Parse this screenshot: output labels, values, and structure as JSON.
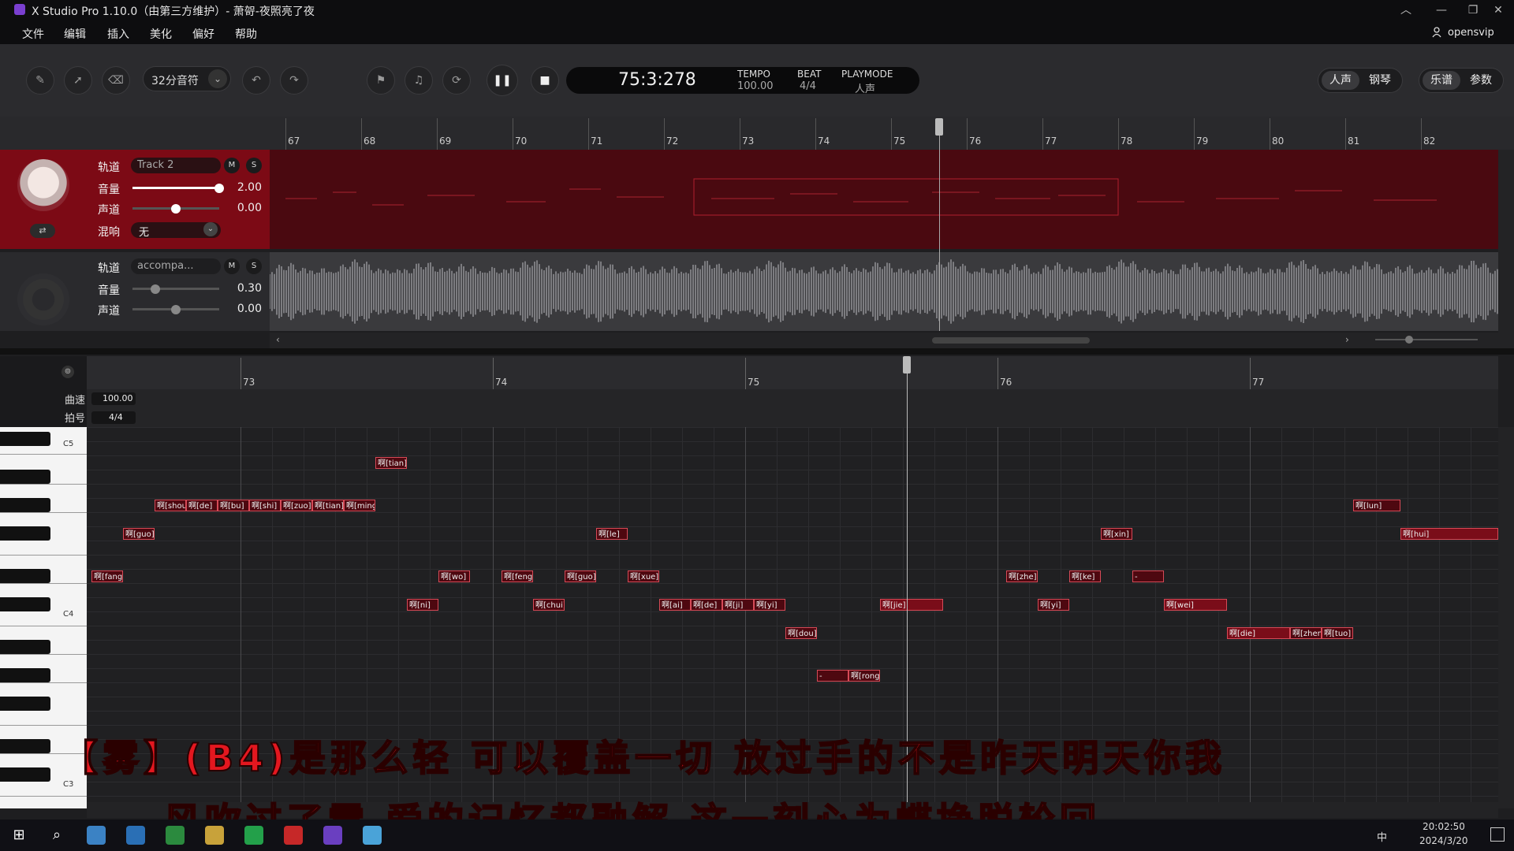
{
  "window": {
    "title": "X Studio Pro 1.10.0（由第三方维护）- 萧哿-夜照亮了夜",
    "controls": {
      "minimize": "—",
      "maximize": "❐",
      "close": "✕",
      "restore": "︿"
    }
  },
  "menu": {
    "items": [
      "文件",
      "编辑",
      "插入",
      "美化",
      "偏好",
      "帮助"
    ],
    "user": "opensvip"
  },
  "toolbar": {
    "note_value": "32分音符",
    "time": "75:3:278",
    "tempo_label": "TEMPO",
    "tempo_value": "100.00",
    "beat_label": "BEAT",
    "beat_value": "4/4",
    "playmode_label": "PLAYMODE",
    "playmode_value": "人声",
    "voice_tabs": [
      "人声",
      "钢琴"
    ],
    "view_tabs": [
      "乐谱",
      "参数"
    ]
  },
  "arrangement": {
    "measures": [
      "67",
      "68",
      "69",
      "70",
      "71",
      "72",
      "73",
      "74",
      "75",
      "76",
      "77",
      "78",
      "79",
      "80",
      "81",
      "82"
    ],
    "track1": {
      "track_label": "轨道",
      "name": "Track 2",
      "mute": "M",
      "solo": "S",
      "volume_label": "音量",
      "volume": "2.00",
      "volume_level": 1.0,
      "pan_label": "声道",
      "pan": "0.00",
      "pan_level": 0.5,
      "reverb_label": "混响",
      "reverb": "无"
    },
    "track2": {
      "track_label": "轨道",
      "name": "accompa...",
      "mute": "M",
      "solo": "S",
      "volume_label": "音量",
      "volume": "0.30",
      "volume_level": 0.15,
      "pan_label": "声道",
      "pan": "0.00",
      "pan_level": 0.5
    }
  },
  "piano_roll": {
    "measures": [
      "73",
      "74",
      "75",
      "76",
      "77"
    ],
    "tempo_label": "曲速",
    "tempo_value": "100.00",
    "beat_label": "拍号",
    "beat_value": "4/4",
    "key_labels": [
      "C5",
      "C4",
      "C3"
    ],
    "notes": [
      {
        "text": "啊[tian]"
      },
      {
        "text": "啊[shou"
      },
      {
        "text": "啊[de]"
      },
      {
        "text": "啊[bu]"
      },
      {
        "text": "啊[shi]"
      },
      {
        "text": "啊[zuo]"
      },
      {
        "text": "啊[tian]"
      },
      {
        "text": "啊[ming"
      },
      {
        "text": "啊[guo]"
      },
      {
        "text": "啊[le]"
      },
      {
        "text": "啊[fang"
      },
      {
        "text": "啊[wo]"
      },
      {
        "text": "啊[feng"
      },
      {
        "text": "啊[guo]"
      },
      {
        "text": "啊[xue]"
      },
      {
        "text": "啊[ni]"
      },
      {
        "text": "啊[chui]"
      },
      {
        "text": "啊[ai]"
      },
      {
        "text": "啊[de]"
      },
      {
        "text": "啊[ji]"
      },
      {
        "text": "啊[yi]"
      },
      {
        "text": "啊[jie]"
      },
      {
        "text": "啊[dou]"
      },
      {
        "text": "-"
      },
      {
        "text": "啊[rong"
      },
      {
        "text": "啊[zhe]"
      },
      {
        "text": "啊[ke]"
      },
      {
        "text": "-"
      },
      {
        "text": "啊[yi]"
      },
      {
        "text": "啊[wei]"
      },
      {
        "text": "啊[xin]"
      },
      {
        "text": "啊[lun]"
      },
      {
        "text": "啊[hui]"
      },
      {
        "text": "啊[die]"
      },
      {
        "text": "啊[zhen"
      },
      {
        "text": "啊[tuo]"
      }
    ]
  },
  "subtitles": {
    "line1": "【雾】(B4)是那么轻 可以覆盖一切 放过手的不是昨天明天你我",
    "line2": "风吹过了雪 爱的记忆都融解 这一刻心为蝶挣脱轮回"
  },
  "taskbar": {
    "time": "20:02:50",
    "date": "2024/3/20",
    "ime": "中"
  },
  "colors": {
    "track_active": "#7c0a15",
    "note_border": "#d64a57",
    "subtitle": "#e3171f"
  }
}
